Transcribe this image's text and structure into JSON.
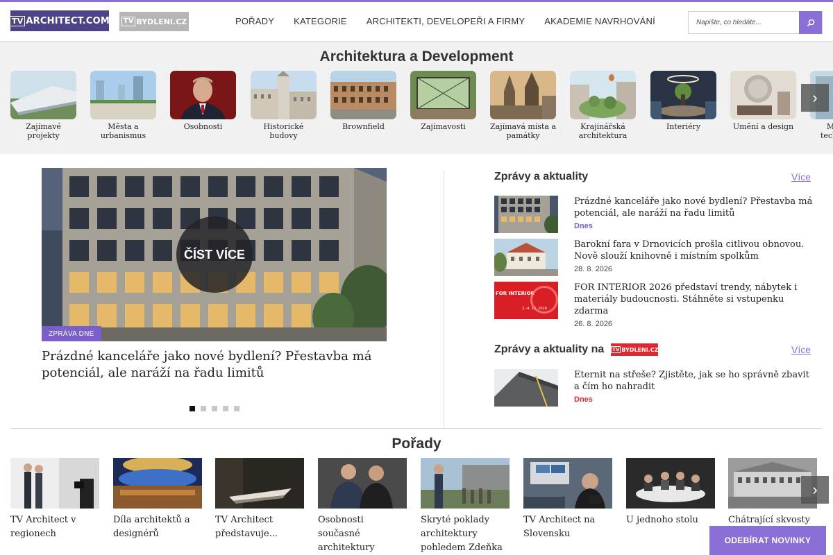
{
  "header": {
    "logo_main": {
      "tv": "TV",
      "rest": "ARCHITECT.COM"
    },
    "logo_secondary": {
      "tv": "TV",
      "rest": "BYDLENI.CZ"
    },
    "nav": [
      "POŘADY",
      "KATEGORIE",
      "ARCHITEKTI, DEVELOPEŘI A FIRMY",
      "AKADEMIE NAVRHOVÁNÍ"
    ],
    "search_placeholder": "Napište, co hledáte...",
    "search_icon": "search-icon",
    "accent_color": "#8a6fd6"
  },
  "categories": {
    "title": "Architektura a Development",
    "items": [
      "Zajímavé projekty",
      "Města a urbanismus",
      "Osobnosti",
      "Historické budovy",
      "Brownfield",
      "Zajímavosti",
      "Zajímavá místa a památky",
      "Krajinářská architektura",
      "Interiéry",
      "Umění a design",
      "Moderní technologie"
    ],
    "next_icon": "chevron-right-icon"
  },
  "featured": {
    "read_more": "ČÍST VÍCE",
    "badge": "ZPRÁVA DNE",
    "title": "Prázdné kanceláře jako nové bydlení? Přestavba má potenciál, ale naráží na řadu limitů",
    "dots": 5,
    "active_dot": 0
  },
  "news": {
    "heading": "Zprávy a aktuality",
    "more": "Více",
    "items": [
      {
        "title": "Prázdné kanceláře jako nové bydlení? Přestavba má potenciál, ale naráží na řadu limitů",
        "date": "Dnes"
      },
      {
        "title": "Barokní fara v Drnovicích prošla citlivou obnovou. Nově slouží knihovně i místním spolkům",
        "date": "28. 8. 2026"
      },
      {
        "title": "FOR INTERIOR 2026 představí trendy, nábytek i materiály budoucnosti. Stáhněte si vstupenku zdarma",
        "date": "26. 8. 2026",
        "thumb_text": "FOR INTERIOR",
        "thumb_date": "2.–4. 10. 2026"
      }
    ]
  },
  "news2": {
    "heading": "Zprávy a aktuality na",
    "logo": {
      "tv": "TV",
      "rest": "BYDLENI.CZ"
    },
    "more": "Více",
    "items": [
      {
        "title": "Eternit na střeše? Zjistěte, jak se ho správně zbavit a čím ho nahradit",
        "date": "Dnes"
      }
    ]
  },
  "shows": {
    "title": "Pořady",
    "items": [
      "TV Architect v regionech",
      "Díla architektů a designérů",
      "TV Architect představuje...",
      "Osobnosti současné architektury",
      "Skryté poklady architektury pohledem Zdeňka",
      "TV Architect na Slovensku",
      "U jednoho stolu",
      "Chátrající skvosty"
    ],
    "next_icon": "chevron-right-icon",
    "subscribe": "ODEBÍRAT NOVINKY"
  }
}
